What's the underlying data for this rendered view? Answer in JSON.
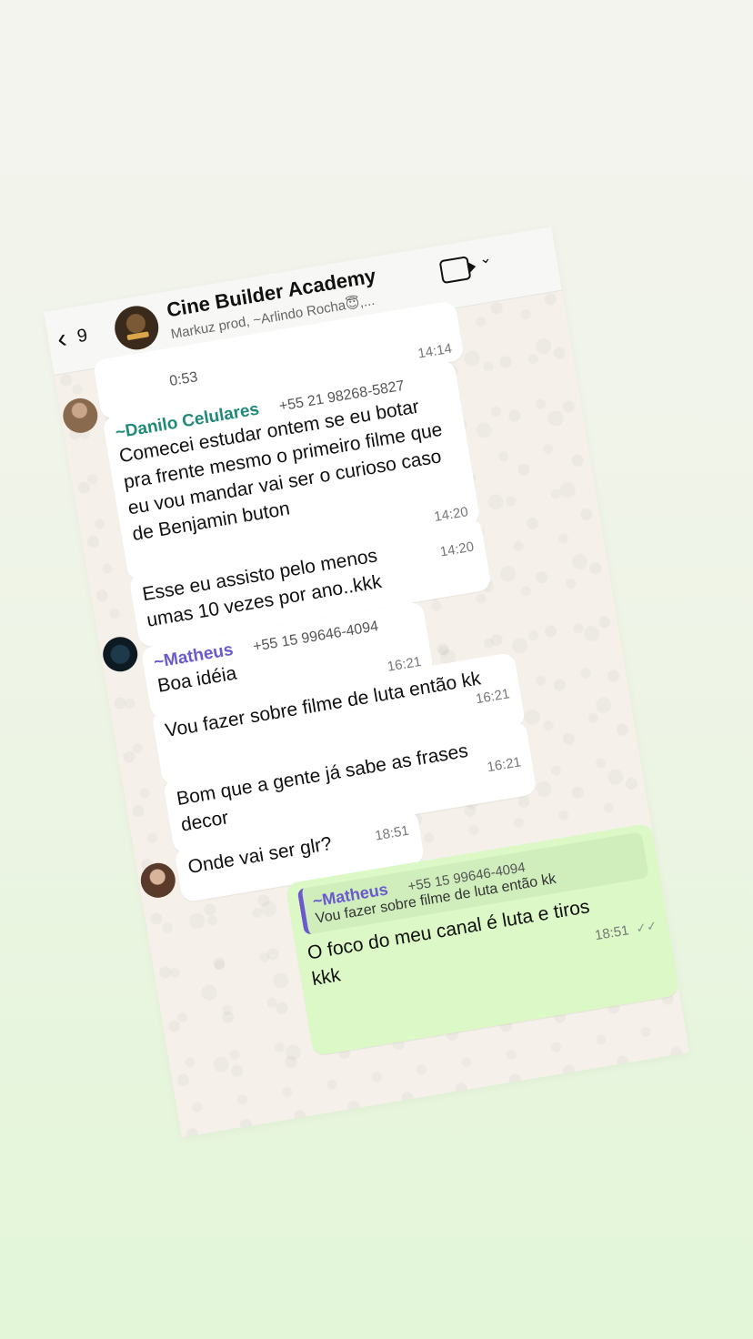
{
  "header": {
    "back_count": "9",
    "title": "Cine Builder Academy",
    "subtitle": "Markuz prod, ~Arlindo Rocha😇,..."
  },
  "messages": [
    {
      "type": "audio-tail",
      "duration": "0:53",
      "time": "14:14"
    },
    {
      "sender": "~Danilo Celulares",
      "phone": "+55 21 98268-5827",
      "text": "Comecei estudar ontem se eu botar pra frente mesmo o primeiro filme que eu vou mandar vai ser o curioso caso de Benjamin buton",
      "time": "14:20"
    },
    {
      "text": "Esse eu assisto pelo menos umas 10 vezes por ano..kkk",
      "time": "14:20"
    },
    {
      "sender": "~Matheus",
      "phone": "+55 15 99646-4094",
      "text": "Boa idéia",
      "time": "16:21"
    },
    {
      "text": "Vou fazer sobre filme de luta então kk",
      "time": "16:21"
    },
    {
      "text": "Bom que a gente já sabe as frases decor",
      "time": "16:21"
    },
    {
      "text": "Onde vai ser glr?",
      "time": "18:51"
    },
    {
      "quote_sender": "~Matheus",
      "quote_phone": "+55 15 99646-4094",
      "quote_text": "Vou fazer sobre filme de luta então kk",
      "text": "O foco do meu canal é luta e tiros kkk",
      "time": "18:51"
    }
  ],
  "colors": {
    "danilo": "#1f8a78",
    "matheus": "#6a5acd",
    "out_bubble": "#dcf8c6"
  }
}
